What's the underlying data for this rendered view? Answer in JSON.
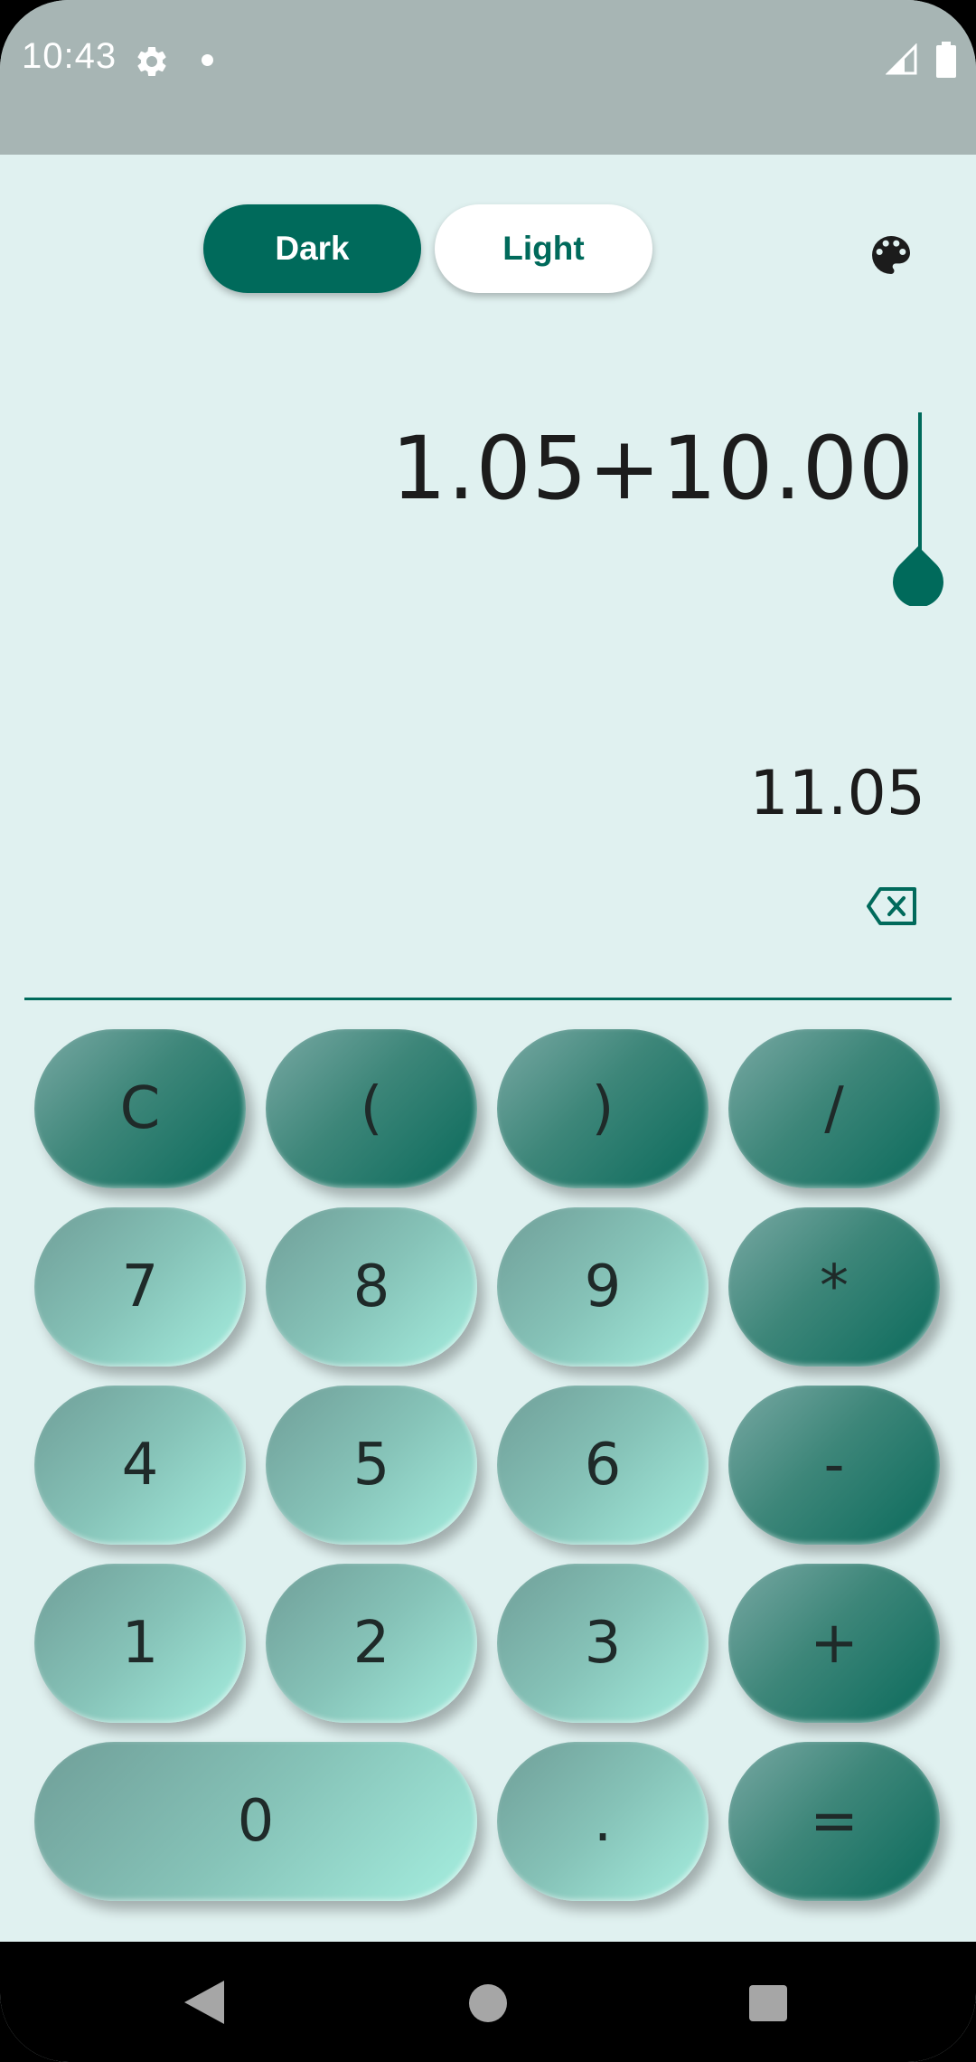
{
  "status_bar": {
    "time": "10:43"
  },
  "theme_toggle": {
    "dark_label": "Dark",
    "light_label": "Light"
  },
  "display": {
    "expression": "1.05+10.00",
    "result": "11.05"
  },
  "keypad": {
    "rows": [
      [
        {
          "label": "C",
          "style": "dark"
        },
        {
          "label": "(",
          "style": "dark"
        },
        {
          "label": ")",
          "style": "dark"
        },
        {
          "label": "/",
          "style": "dark"
        }
      ],
      [
        {
          "label": "7",
          "style": "light"
        },
        {
          "label": "8",
          "style": "light"
        },
        {
          "label": "9",
          "style": "light"
        },
        {
          "label": "*",
          "style": "dark"
        }
      ],
      [
        {
          "label": "4",
          "style": "light"
        },
        {
          "label": "5",
          "style": "light"
        },
        {
          "label": "6",
          "style": "light"
        },
        {
          "label": "-",
          "style": "dark"
        }
      ],
      [
        {
          "label": "1",
          "style": "light"
        },
        {
          "label": "2",
          "style": "light"
        },
        {
          "label": "3",
          "style": "light"
        },
        {
          "label": "+",
          "style": "dark"
        }
      ],
      [
        {
          "label": "0",
          "style": "light"
        },
        {
          "label": ".",
          "style": "light"
        },
        {
          "label": "=",
          "style": "dark"
        }
      ]
    ]
  },
  "colors": {
    "accent": "#006a5b",
    "background": "#e0f1f0",
    "status_bar": "#a7b5b4",
    "key_dark_end": "#08695a",
    "key_light_end": "#a6efe0"
  },
  "icons": {
    "status": [
      "gear-icon",
      "notification-dot-icon",
      "signal-icon",
      "battery-icon"
    ],
    "header": "palette-icon",
    "display": "backspace-icon",
    "nav": [
      "back-icon",
      "home-icon",
      "recents-icon"
    ]
  }
}
